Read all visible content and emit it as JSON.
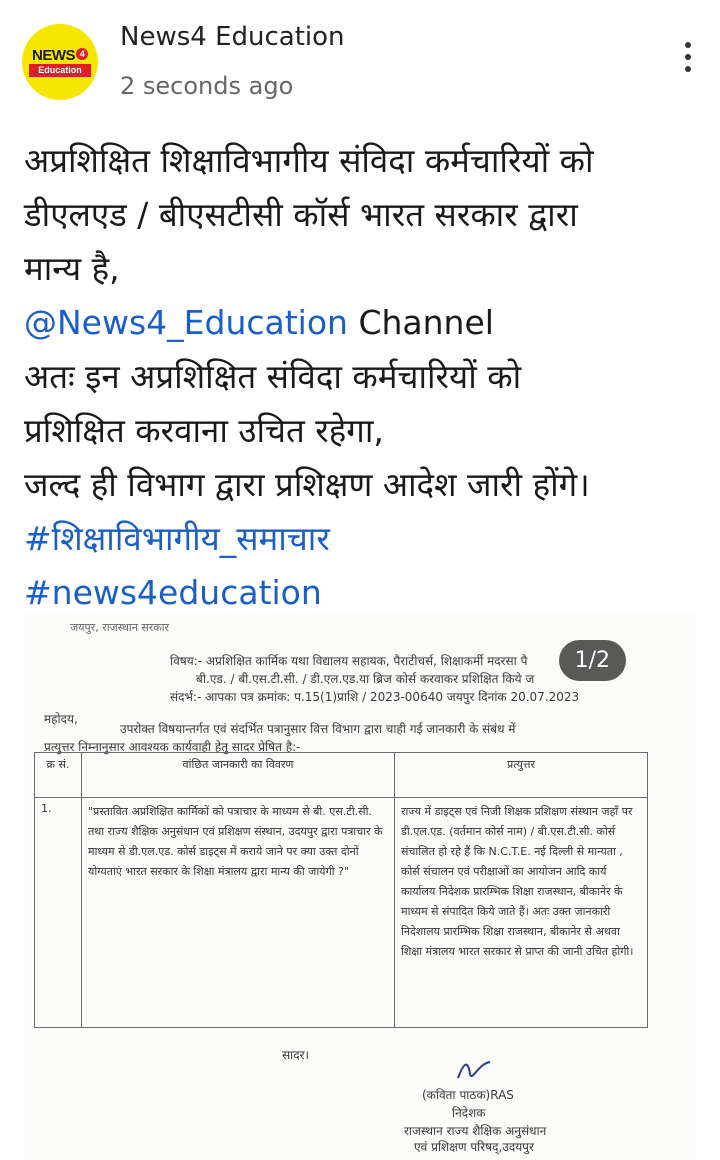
{
  "header": {
    "avatar_logo": {
      "top": "NEWS",
      "badge": "4",
      "bottom": "Education"
    },
    "channel_name": "News4 Education",
    "timestamp": "2 seconds ago"
  },
  "post": {
    "lines": [
      "अप्रशिक्षित शिक्षाविभागीय संविदा कर्मचारियों को",
      "डीएलएड / बीएसटीसी कॉर्स भारत सरकार द्वारा",
      "मान्य है,"
    ],
    "mention": "@News4_Education",
    "mention_suffix": " Channel",
    "lines2": [
      "अतः इन अप्रशिक्षित संविदा कर्मचारियों को",
      "प्रशिक्षित करवाना उचित रहेगा,",
      "जल्द ही विभाग द्वारा प्रशिक्षण आदेश जारी होंगे।"
    ],
    "hashtags": [
      "#शिक्षाविभागीय_समाचार",
      "#news4education"
    ]
  },
  "image": {
    "counter": "1/2",
    "doc": {
      "top_line": "जयपुर, राजस्थान सरकार",
      "subject_1": "विषय:- अप्रशिक्षित कार्मिक यथा विद्यालय सहायक, पैराटीचर्स, शिक्षाकर्मी मदरसा पै",
      "subject_2": "बी.एड. / बी.एस.टी.सी. / डी.एल.एड.या ब्रिज कोर्स करवाकर प्रशिक्षित किये ज",
      "reference": "संदर्भ:- आपका पत्र क्रमांक: प.15(1)प्राशि / 2023-00640 जयपुर दिनांक 20.07.2023",
      "salutation": "महोदय,",
      "para_1": "उपरोक्त विषयान्तर्गत एवं संदर्भित पत्रानुसार वित्त विभाग द्वारा चाही गई जानकारी के संबंध में",
      "para_2": "प्रत्युत्तर निम्नानुसार आवश्यक कार्यवाही हेतु सादर प्रेषित है:-",
      "table_headers": [
        "क्र सं.",
        "वांछित जानकारी का विवरण",
        "प्रत्युत्तर"
      ],
      "row_no": "1.",
      "row_question": "\"प्रस्तावित अप्रशिक्षित कार्मिकों को पत्राचार के माध्यम से बी. एस.टी.सी. तथा राज्य शैक्षिक अनुसंधान एवं प्रशिक्षण संस्थान, उदयपुर द्वारा पत्राचार के माध्यम से डी.एल.एड. कोर्स डाइट्स में कराये जाने पर क्या उक्त दोनों योग्यताएं भारत सरकार के शिक्षा मंत्रालय द्वारा मान्य की जायेगी ?\"",
      "row_answer": "राज्य में डाइट्स एवं निजी शिक्षक प्रशिक्षण संस्थान जहाँ पर डी.एल.एड. (वर्तमान कोर्स नाम) / बी.एस.टी.सी. कोर्स संचालित हो रहे हैं कि N.C.T.E. नई दिल्ली से मान्यता , कोर्स संचालन एवं परीक्षाओं का आयोजन आदि कार्य कार्यालय निदेशक प्रारम्भिक शिक्षा राजस्थान, बीकानेर के माध्यम से संपादित किये जाते हैं। अतः उक्त जानकारी निदेशालय प्रारम्भिक शिक्षा राजस्थान, बीकानेर से अथवा शिक्षा मंत्रालय भारत सरकार से प्राप्त की जानी उचित होगी।",
      "closing": "सादर।",
      "signatory_name": "(कविता पाठक)RAS",
      "signatory_title": "निदेशक",
      "signatory_org_1": "राजस्थान राज्य शैक्षिक अनुसंधान",
      "signatory_org_2": "एवं प्रशिक्षण परिषद्,उदयपुर"
    }
  },
  "colors": {
    "link": "#1a5fc9",
    "avatar_bg": "#f7e600",
    "logo_red": "#e02020"
  },
  "icons": [
    "more-vertical-icon"
  ]
}
